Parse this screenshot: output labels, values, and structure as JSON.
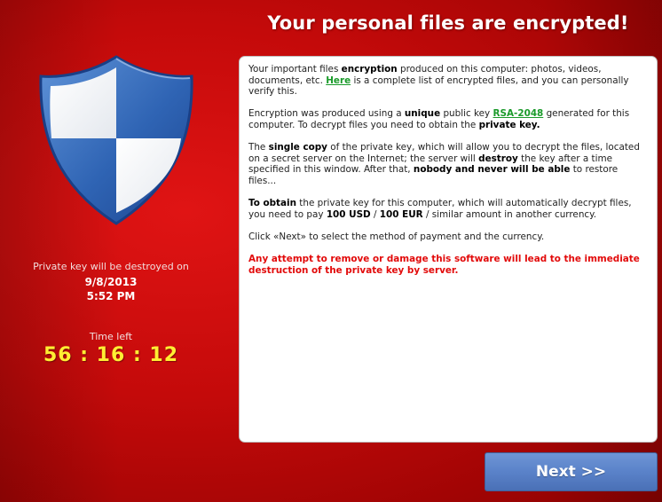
{
  "window": {
    "title": "Your personal files are encrypted!",
    "background_color": "#c40a0a",
    "accent_color": "#ffee33"
  },
  "sidebar": {
    "shield_icon": "shield-icon",
    "destroy_label": "Private key will be destroyed on",
    "destroy_date": "9/8/2013",
    "destroy_time": "5:52 PM",
    "time_left_label": "Time left",
    "countdown": "56 : 16 : 12"
  },
  "message": {
    "p1": {
      "t1": "Your important files ",
      "b1": "encryption",
      "t2": " produced on this computer: photos, videos, documents, etc. ",
      "link": "Here",
      "t3": " is a complete list of encrypted files, and you can personally verify this."
    },
    "p2": {
      "t1": "Encryption was produced using a ",
      "b1": "unique",
      "t2": " public key ",
      "link": "RSA-2048",
      "t3": " generated for this computer. To decrypt files you need to obtain the ",
      "b2": "private key."
    },
    "p3": {
      "t1": "The ",
      "b1": "single copy",
      "t2": " of the private key, which will allow you to decrypt the files, located on a secret server on the Internet; the server will ",
      "b2": "destroy",
      "t3": " the key after a time specified in this window. After that, ",
      "b3": "nobody and never will be able",
      "t4": " to restore files..."
    },
    "p4": {
      "b1": "To obtain",
      "t1": " the private key for this computer, which will automatically decrypt files, you need to pay ",
      "b2": "100 USD",
      "t2": " / ",
      "b3": "100 EUR",
      "t3": " / similar amount in another currency."
    },
    "p5": "Click «Next» to select the method of payment and the currency.",
    "warning": "Any attempt to remove or damage this software will lead to the immediate destruction of the private key by server.",
    "warning_color": "#e20a0a",
    "link_color": "#1a9a2a"
  },
  "buttons": {
    "next_label": "Next >>"
  }
}
